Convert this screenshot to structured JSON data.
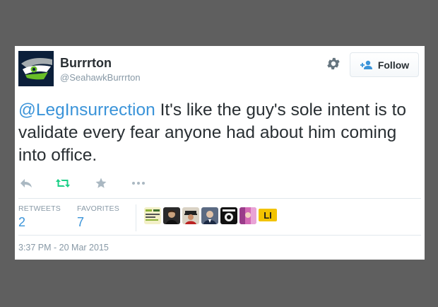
{
  "tweet": {
    "author": {
      "name": "Burrrton",
      "handle": "@SeahawkBurrrton"
    },
    "follow_label": "Follow",
    "text": {
      "mention": "@LegInsurrection",
      "body": " It's like the guy's sole intent is to validate every fear anyone had about him coming into office."
    },
    "stats": {
      "retweets_label": "RETWEETS",
      "retweets_value": "2",
      "favorites_label": "FAVORITES",
      "favorites_value": "7"
    },
    "favoriters_badge": "LI",
    "timestamp": "3:37 PM - 20 Mar 2015"
  },
  "colors": {
    "link": "#3b94d9",
    "text": "#292f33",
    "muted": "#8899a6",
    "retweet_green": "#19cf86",
    "background": "#5f5f5f"
  },
  "icons": {
    "reply": "reply-arrow-icon",
    "retweet": "retweet-icon",
    "favorite": "star-icon",
    "more": "ellipsis-icon",
    "settings": "gear-icon",
    "follow": "add-user-icon"
  }
}
